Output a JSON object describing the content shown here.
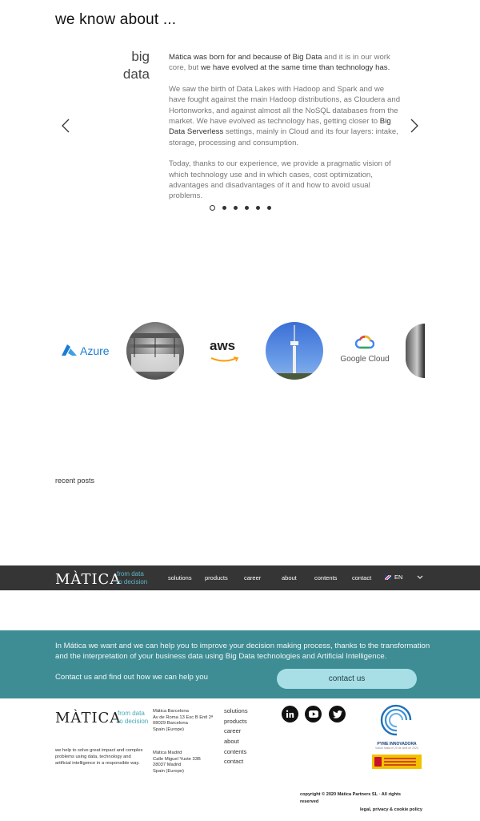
{
  "section": {
    "heading": "we know about ..."
  },
  "slide": {
    "title_line1": "big",
    "title_line2": "data",
    "p1_a": "Mática was born for and because of Big Data",
    "p1_b": " and it is in our work core, but ",
    "p1_c": "we have evolved at the same time than technology has.",
    "p2_a": "We saw the birth of Data Lakes with Hadoop and Spark and we have fought against the main Hadoop distributions, as Cloudera and Hortonworks, and against almost all the NoSQL databases from the market. We have evolved as technology has, getting closer to ",
    "p2_b": "Big Data Serverless",
    "p2_c": " settings, mainly in Cloud and its four layers: intake, storage, processing and consumption.",
    "p3": "Today, thanks to our experience, we provide a pragmatic vision of which technology use and in which cases, cost optimization, advantages and disadvantages of it and how to avoid usual problems."
  },
  "slider": {
    "dot_count": 6,
    "active_index": 0
  },
  "logos": {
    "azure": "Azure",
    "aws": "aws",
    "google_cloud": "Google Cloud"
  },
  "recent_posts": {
    "label": "recent posts"
  },
  "nav": {
    "brand": "MÀTICA",
    "tagline_1": "from data",
    "tagline_2": "to decision",
    "items": [
      "solutions",
      "products",
      "career",
      "about",
      "contents",
      "contact"
    ],
    "language": "EN"
  },
  "cta": {
    "text": "In Mática we want and we can help you to improve your decision making process, thanks to the transformation and the interpretation of your business data using Big Data technologies and Artificial Intelligence.",
    "sub": "Contact us and find out how we can help you",
    "button": "contact us",
    "band_color": "#3e8d95",
    "button_color": "#a8dfe6"
  },
  "footer": {
    "brand": "MÀTICA",
    "tagline_1": "from data",
    "tagline_2": "to decision",
    "description": "we help to solve great impact and complex problems using data, technology and artificial intelligence in a responsible way.",
    "barcelona": [
      "Mática Barcelona",
      "Av de Roma 13 Esc B Entl 2ª",
      "08029 Barcelona",
      "Spain (Europe)"
    ],
    "madrid": [
      "Mática Madrid",
      "Calle Miguel Yuste 33B",
      "28037 Madrid",
      "Spain (Europe)"
    ],
    "links": [
      "solutions",
      "products",
      "career",
      "about",
      "contents",
      "contact"
    ],
    "social": [
      "linkedin-icon",
      "youtube-icon",
      "twitter-icon"
    ],
    "badge_title": "PYME INNOVADORA",
    "badge_sub": "Válido hasta el 20 de abril de 2023",
    "copyright": "copyright © 2020 Mática Partners SL · All rights reserved",
    "legal": "legal, privacy & cookie policy"
  }
}
